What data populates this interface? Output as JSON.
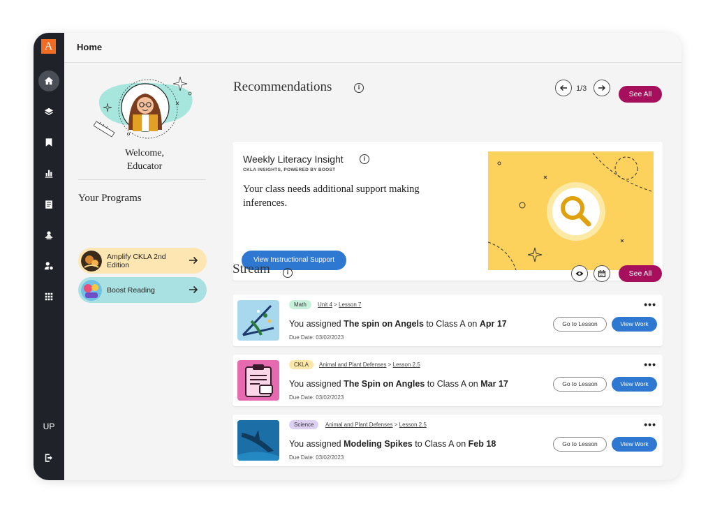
{
  "app": {
    "logo_letter": "A",
    "page_title": "Home"
  },
  "rail": {
    "items": [
      "home-icon",
      "layers-icon",
      "bookmark-icon",
      "bar-chart-icon",
      "document-icon",
      "presenter-icon",
      "user-settings-icon",
      "apps-grid-icon"
    ],
    "user_initials": "UP",
    "logout_icon": "logout-icon"
  },
  "profile": {
    "welcome_line1": "Welcome,",
    "welcome_line2": "Educator"
  },
  "programs": {
    "heading": "Your Programs",
    "items": [
      {
        "label": "Amplify CKLA 2nd Edition",
        "color": "#fde6b1"
      },
      {
        "label": "Boost Reading",
        "color": "#a9e0e1"
      }
    ]
  },
  "recommendations": {
    "title": "Recommendations",
    "pager": "1/3",
    "see_all": "See All",
    "card": {
      "title": "Weekly Literacy Insight",
      "subtitle": "CKLA INSIGHTS, POWERED BY BOOST",
      "text": "Your class needs additional support making inferences.",
      "button": "View Instructional Support"
    }
  },
  "stream": {
    "title": "Stream",
    "see_all": "See All",
    "items": [
      {
        "tag": "Math",
        "tag_color": "#c7f0dd",
        "crumb_a": "Unit 4",
        "crumb_b": "Lesson 7",
        "prefix": "You assigned",
        "assignment": "The spin on Angels",
        "middle": "to Class A on",
        "date": "Apr 17",
        "due": "Due Date: 03/02/2023",
        "btn_lesson": "Go to Lesson",
        "btn_view": "View Work"
      },
      {
        "tag": "CKLA",
        "tag_color": "#fde6a8",
        "crumb_a": "Animal and Plant Defenses",
        "crumb_b": "Lesson 2.5",
        "prefix": "You assigned",
        "assignment": "The Spin on Angles",
        "middle": "to Class A on",
        "date": "Mar 17",
        "due": "Due Date: 03/02/2023",
        "btn_lesson": "Go to Lesson",
        "btn_view": "View Work"
      },
      {
        "tag": "Science",
        "tag_color": "#ddd0f3",
        "crumb_a": "Animal and Plant Defenses",
        "crumb_b": "Lesson 2.5",
        "prefix": "You assigned",
        "assignment": "Modeling Spikes",
        "middle": "to Class A on",
        "date": "Feb 18",
        "due": "Due Date: 03/02/2023",
        "btn_lesson": "Go to Lesson",
        "btn_view": "View Work"
      }
    ]
  },
  "colors": {
    "brand_orange": "#f26b21",
    "accent_magenta": "#a50f5c",
    "primary_blue": "#2e78d2",
    "rail_bg": "#1f2329"
  }
}
